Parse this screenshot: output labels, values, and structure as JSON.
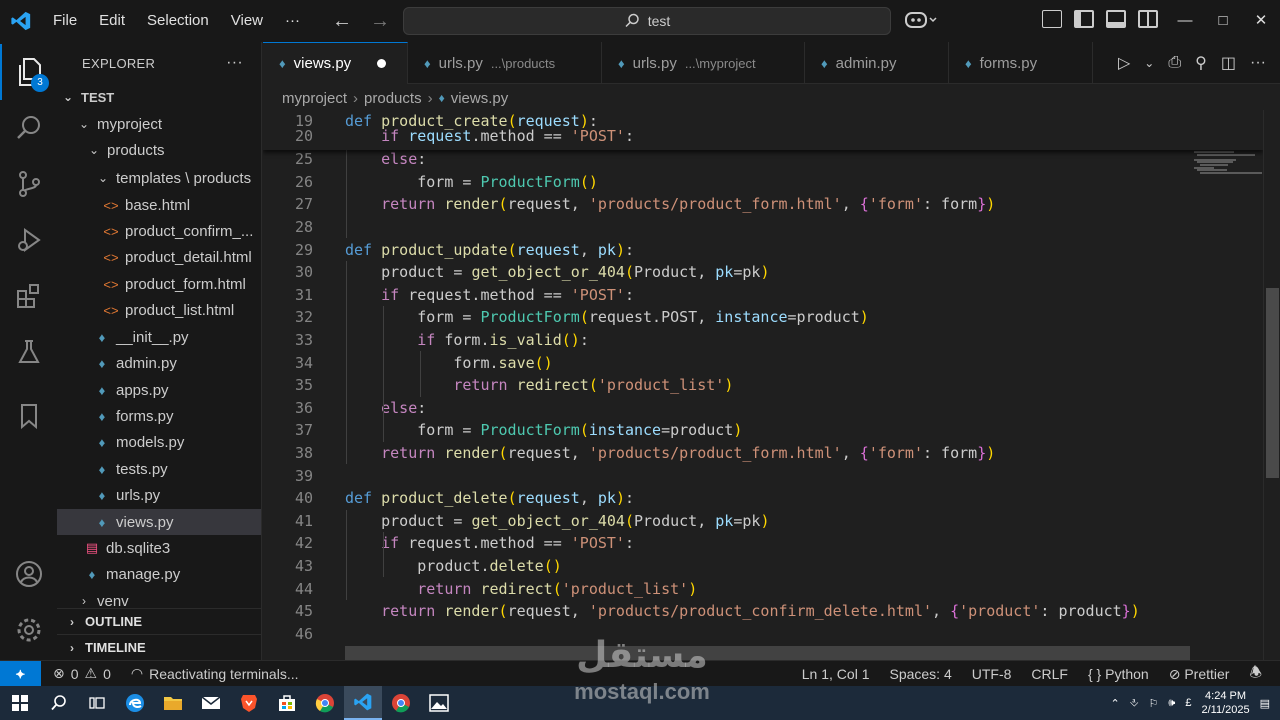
{
  "titlebar": {
    "menu": [
      "File",
      "Edit",
      "Selection",
      "View",
      "···"
    ],
    "search": "test"
  },
  "activity": {
    "badge": "3"
  },
  "explorer": {
    "title": "EXPLORER",
    "more": "···",
    "items": [
      {
        "label": "TEST",
        "bold": true
      },
      {
        "label": "myproject"
      },
      {
        "label": "products"
      },
      {
        "label": "templates \\ products"
      },
      {
        "label": "base.html"
      },
      {
        "label": "product_confirm_..."
      },
      {
        "label": "product_detail.html"
      },
      {
        "label": "product_form.html"
      },
      {
        "label": "product_list.html"
      },
      {
        "label": "__init__.py"
      },
      {
        "label": "admin.py"
      },
      {
        "label": "apps.py"
      },
      {
        "label": "forms.py"
      },
      {
        "label": "models.py"
      },
      {
        "label": "tests.py"
      },
      {
        "label": "urls.py"
      },
      {
        "label": "views.py"
      },
      {
        "label": "db.sqlite3"
      },
      {
        "label": "manage.py"
      },
      {
        "label": "venv"
      }
    ],
    "outline": "OUTLINE",
    "timeline": "TIMELINE"
  },
  "tabs": [
    {
      "label": "views.py",
      "path": "",
      "active": true
    },
    {
      "label": "urls.py",
      "path": "...\\products"
    },
    {
      "label": "urls.py",
      "path": "...\\myproject"
    },
    {
      "label": "admin.py",
      "path": ""
    },
    {
      "label": "forms.py",
      "path": ""
    }
  ],
  "breadcrumb": [
    "myproject",
    "products",
    "views.py"
  ],
  "editor": {
    "lines": [
      {
        "n": "19",
        "html": "<span class='kw'>def</span> <span class='fn'>product_create</span><span class='br1'>(</span><span class='param'>request</span><span class='br1'>)</span>:"
      },
      {
        "n": "20",
        "html": "    <span class='kw2'>if</span> <span class='param'>request</span>.method == <span class='str'>'POST'</span>:"
      },
      {
        "n": "25",
        "html": "    <span class='kw2'>else</span>:"
      },
      {
        "n": "26",
        "html": "        form = <span class='cls'>ProductForm</span><span class='br1'>()</span>"
      },
      {
        "n": "27",
        "html": "    <span class='kw2'>return</span> <span class='fn'>render</span><span class='br1'>(</span>request, <span class='str'>'products/product_form.html'</span>, <span class='br2'>{</span><span class='str'>'form'</span>: form<span class='br2'>}</span><span class='br1'>)</span>"
      },
      {
        "n": "28",
        "html": ""
      },
      {
        "n": "29",
        "html": "<span class='kw'>def</span> <span class='fn'>product_update</span><span class='br1'>(</span><span class='param'>request</span>, <span class='param'>pk</span><span class='br1'>)</span>:"
      },
      {
        "n": "30",
        "html": "    product = <span class='fn'>get_object_or_404</span><span class='br1'>(</span>Product, <span class='param'>pk</span>=pk<span class='br1'>)</span>"
      },
      {
        "n": "31",
        "html": "    <span class='kw2'>if</span> request.method == <span class='str'>'POST'</span>:"
      },
      {
        "n": "32",
        "html": "        form = <span class='cls'>ProductForm</span><span class='br1'>(</span>request.POST, <span class='param'>instance</span>=product<span class='br1'>)</span>"
      },
      {
        "n": "33",
        "html": "        <span class='kw2'>if</span> form.<span class='fn'>is_valid</span><span class='br1'>()</span>:"
      },
      {
        "n": "34",
        "html": "            form.<span class='fn'>save</span><span class='br1'>()</span>"
      },
      {
        "n": "35",
        "html": "            <span class='kw2'>return</span> <span class='fn'>redirect</span><span class='br1'>(</span><span class='str'>'product_list'</span><span class='br1'>)</span>"
      },
      {
        "n": "36",
        "html": "    <span class='kw2'>else</span>:"
      },
      {
        "n": "37",
        "html": "        form = <span class='cls'>ProductForm</span><span class='br1'>(</span><span class='param'>instance</span>=product<span class='br1'>)</span>"
      },
      {
        "n": "38",
        "html": "    <span class='kw2'>return</span> <span class='fn'>render</span><span class='br1'>(</span>request, <span class='str'>'products/product_form.html'</span>, <span class='br2'>{</span><span class='str'>'form'</span>: form<span class='br2'>}</span><span class='br1'>)</span>"
      },
      {
        "n": "39",
        "html": ""
      },
      {
        "n": "40",
        "html": "<span class='kw'>def</span> <span class='fn'>product_delete</span><span class='br1'>(</span><span class='param'>request</span>, <span class='param'>pk</span><span class='br1'>)</span>:"
      },
      {
        "n": "41",
        "html": "    product = <span class='fn'>get_object_or_404</span><span class='br1'>(</span>Product, <span class='param'>pk</span>=pk<span class='br1'>)</span>"
      },
      {
        "n": "42",
        "html": "    <span class='kw2'>if</span> request.method == <span class='str'>'POST'</span>:"
      },
      {
        "n": "43",
        "html": "        product.<span class='fn'>delete</span><span class='br1'>()</span>"
      },
      {
        "n": "44",
        "html": "        <span class='kw2'>return</span> <span class='fn'>redirect</span><span class='br1'>(</span><span class='str'>'product_list'</span><span class='br1'>)</span>"
      },
      {
        "n": "45",
        "html": "    <span class='kw2'>return</span> <span class='fn'>render</span><span class='br1'>(</span>request, <span class='str'>'products/product_confirm_delete.html'</span>, <span class='br2'>{</span><span class='str'>'product'</span>: product<span class='br2'>}</span><span class='br1'>)</span>"
      },
      {
        "n": "46",
        "html": ""
      }
    ]
  },
  "status": {
    "remote": "⯌",
    "errors": "0",
    "warnings": "0",
    "message": "Reactivating terminals...",
    "position": "Ln 1, Col 1",
    "spaces": "Spaces: 4",
    "encoding": "UTF-8",
    "eol": "CRLF",
    "language": "Python",
    "formatter": "Prettier"
  },
  "watermark": {
    "arabic": "مستقل",
    "latin": "mostaql.com"
  },
  "taskbar": {
    "time": "4:24 PM",
    "date": "2/11/2025"
  },
  "colors": {
    "accent": "#0078d4",
    "keyword": "#569cd6",
    "control": "#c586c0",
    "function": "#dcdcaa",
    "string": "#ce9178",
    "param": "#9cdcfe",
    "class": "#4ec9b0"
  }
}
